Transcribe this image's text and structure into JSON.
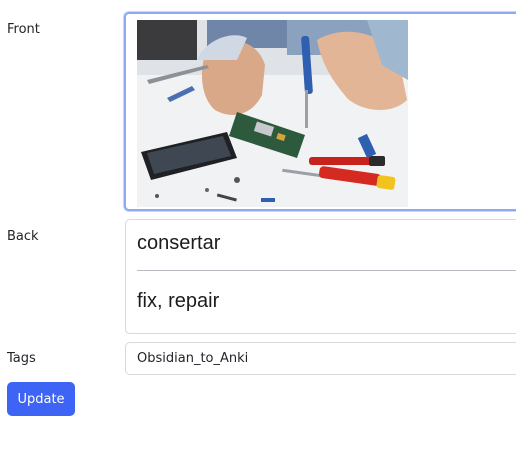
{
  "form": {
    "front_label": "Front",
    "back_label": "Back",
    "tags_label": "Tags",
    "back_text_top": "consertar",
    "back_text_bottom": "fix, repair",
    "tags_value": "Obsidian_to_Anki",
    "update_label": "Update"
  },
  "colors": {
    "accent": "#3d64f4",
    "focus_border": "#8fa8f6",
    "field_border": "#d6d9de"
  }
}
